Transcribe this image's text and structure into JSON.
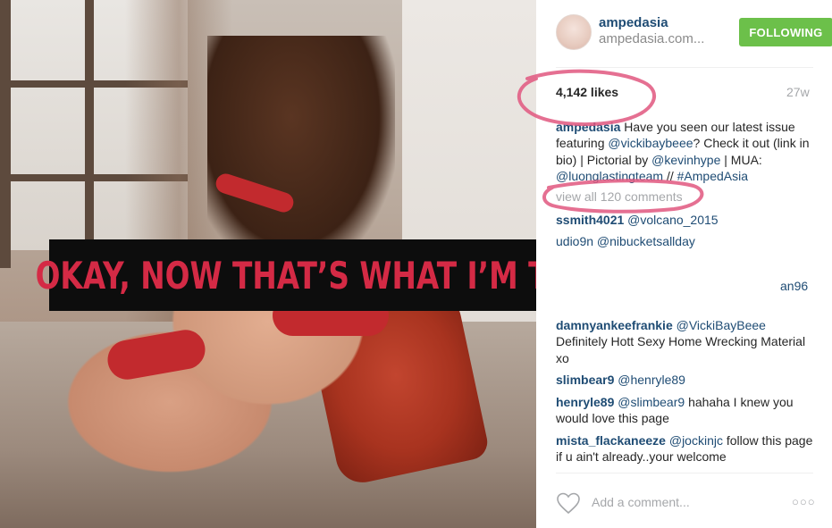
{
  "banner": {
    "text": "OKAY, NOW THAT’S WHAT I’M TALKING ABOUT"
  },
  "post": {
    "username": "ampedasia",
    "site": "ampedasia.com...",
    "follow_label": "FOLLOWING",
    "likes": "4,142 likes",
    "age": "27w",
    "caption": {
      "user": "ampedasia",
      "parts": [
        {
          "text": " Have you seen our latest issue featuring ",
          "mention": false
        },
        {
          "text": "@vickibaybeee",
          "mention": true
        },
        {
          "text": "? Check it out (link in bio) | Pictorial by ",
          "mention": false
        },
        {
          "text": "@kevinhype",
          "mention": true
        },
        {
          "text": " | MUA: ",
          "mention": false
        },
        {
          "text": "@luonglastingteam",
          "mention": true
        },
        {
          "text": " // ",
          "mention": false
        },
        {
          "text": "#AmpedAsia",
          "mention": true
        }
      ]
    },
    "view_all": "view all 120 comments",
    "partial_line_1": "udio9n @nibucketsallday",
    "partial_line_2": "an96",
    "comments": [
      {
        "user": "ssmith4021",
        "mention": "@volcano_2015",
        "text": ""
      },
      {
        "user": "damnyankeefrankie",
        "mention": "@VickiBayBeee",
        "text": "Definitely Hott Sexy Home Wrecking Material xo"
      },
      {
        "user": "slimbear9",
        "mention": "@henryle89",
        "text": ""
      },
      {
        "user": "henryle89",
        "mention": "@slimbear9",
        "text": "hahaha I knew you would love this page"
      },
      {
        "user": "mista_flackaneeze",
        "mention": "@jockinjc",
        "text": "follow this page if u ain't already..your welcome"
      }
    ],
    "add_comment_placeholder": "Add a comment...",
    "more_icon": "ellipsis-icon",
    "like_icon": "heart-outline-icon"
  },
  "colors": {
    "banner_bg": "#0d0d0d",
    "banner_text": "#d42a45",
    "link_blue": "#1f4c74",
    "follow_green": "#6cc04a",
    "annotation_pink": "#e0577f"
  }
}
